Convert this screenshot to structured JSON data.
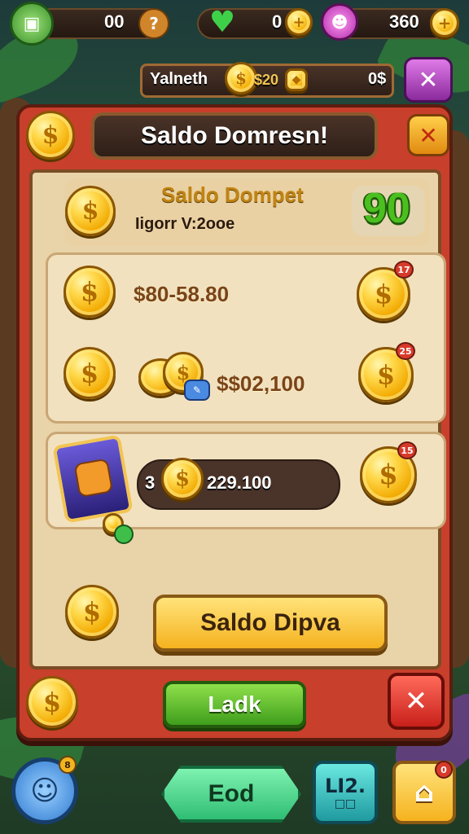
{
  "top_bar": {
    "left_value": "00",
    "hearts_value": "0",
    "gems_value": "360"
  },
  "sub_bar": {
    "label": "Yalneth",
    "value": "$20",
    "right_value": "0$"
  },
  "panel": {
    "title": "Saldo Domresn!",
    "header_title": "Saldo Dompet",
    "header_subtitle": "Iigorr V:2ooe",
    "header_score": "90",
    "row1_amount": "$80-58.80",
    "row2_amount": "$$02,100",
    "row3_amount": "229.100",
    "row3_prefix": "3",
    "badge1": "17",
    "badge2": "25",
    "badge3": "15",
    "primary_button": "Saldo Dipva",
    "secondary_button": "Ladk"
  },
  "bottom_bar": {
    "nav_label": "Eod",
    "level_label": "LI2.",
    "level_sub": "□□",
    "left_badge": "8",
    "right_badge": "0"
  },
  "colors": {
    "panel_red": "#c83f2b",
    "parchment": "#e9d3a8",
    "coin_gold": "#ffd84a",
    "button_yellow": "#f5b21f",
    "button_green": "#3f9e1c"
  }
}
